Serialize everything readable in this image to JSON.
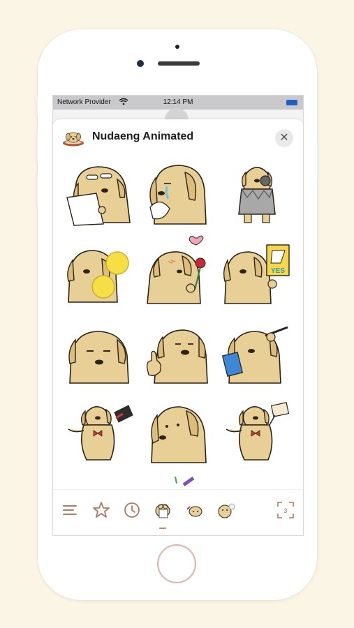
{
  "status_bar": {
    "carrier": "Network Provider",
    "time": "12:14 PM"
  },
  "sheet": {
    "title": "Nudaeng Animated",
    "close_label": "✕"
  },
  "stickers": [
    {
      "name": "dog-reading-paper"
    },
    {
      "name": "dog-crying-tissue"
    },
    {
      "name": "dog-in-armor"
    },
    {
      "name": "dog-cheerleader-pompoms"
    },
    {
      "name": "dog-holding-rose"
    },
    {
      "name": "dog-yes-sign"
    },
    {
      "name": "dog-smug-face"
    },
    {
      "name": "dog-thumbs-up"
    },
    {
      "name": "dog-writing-notepad"
    },
    {
      "name": "dog-magician-hat"
    },
    {
      "name": "dog-sad-looking-away"
    },
    {
      "name": "dog-holding-letter"
    }
  ],
  "yes_sign_text": "YES",
  "toolbar": {
    "items": [
      "menu-icon",
      "star-icon",
      "recents-clock-icon",
      "sticker-pack-1",
      "sticker-pack-2",
      "sticker-pack-3",
      "expand-icon"
    ],
    "expand_label": "3",
    "accent": "#b07a62"
  }
}
